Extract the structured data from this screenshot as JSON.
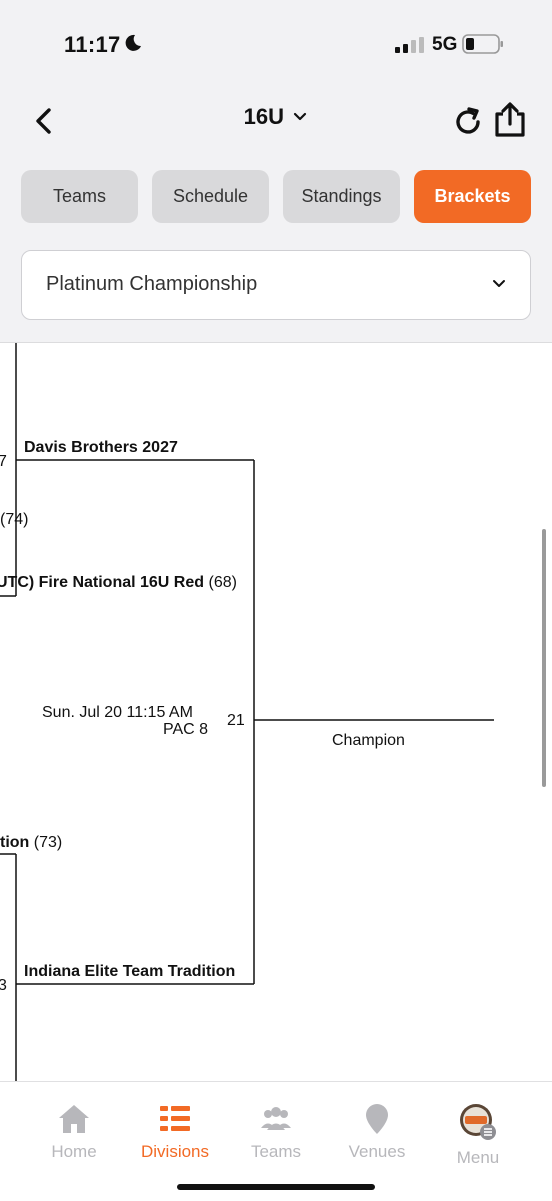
{
  "status": {
    "time": "11:17",
    "network": "5G"
  },
  "header": {
    "title": "16U"
  },
  "tabs": [
    {
      "label": "Teams"
    },
    {
      "label": "Schedule"
    },
    {
      "label": "Standings"
    },
    {
      "label": "Brackets",
      "active": true
    }
  ],
  "division_select": {
    "value": "Platinum Championship"
  },
  "bracket": {
    "partial_score_1": "7",
    "team_top": "Davis Brothers 2027",
    "partial_seed_1": "(74)",
    "team_top2_name": "UTC) Fire National 16U Red",
    "team_top2_seed": "(68)",
    "game_datetime": "Sun. Jul 20 11:15 AM",
    "game_venue": "PAC 8",
    "game_number": "21",
    "champion_label": "Champion",
    "team_bottom1_name": "tion",
    "team_bottom1_seed": "(73)",
    "team_bottom": "Indiana Elite Team Tradition",
    "partial_score_2": "3"
  },
  "bottom_nav": [
    {
      "label": "Home",
      "icon": "home-icon"
    },
    {
      "label": "Divisions",
      "icon": "divisions-icon",
      "active": true
    },
    {
      "label": "Teams",
      "icon": "teams-icon"
    },
    {
      "label": "Venues",
      "icon": "venue-pin-icon"
    },
    {
      "label": "Menu",
      "icon": "menu-logo-icon"
    }
  ],
  "colors": {
    "accent": "#f26a25",
    "tab_inactive": "#d9d9db",
    "background": "#f2f2f4"
  }
}
